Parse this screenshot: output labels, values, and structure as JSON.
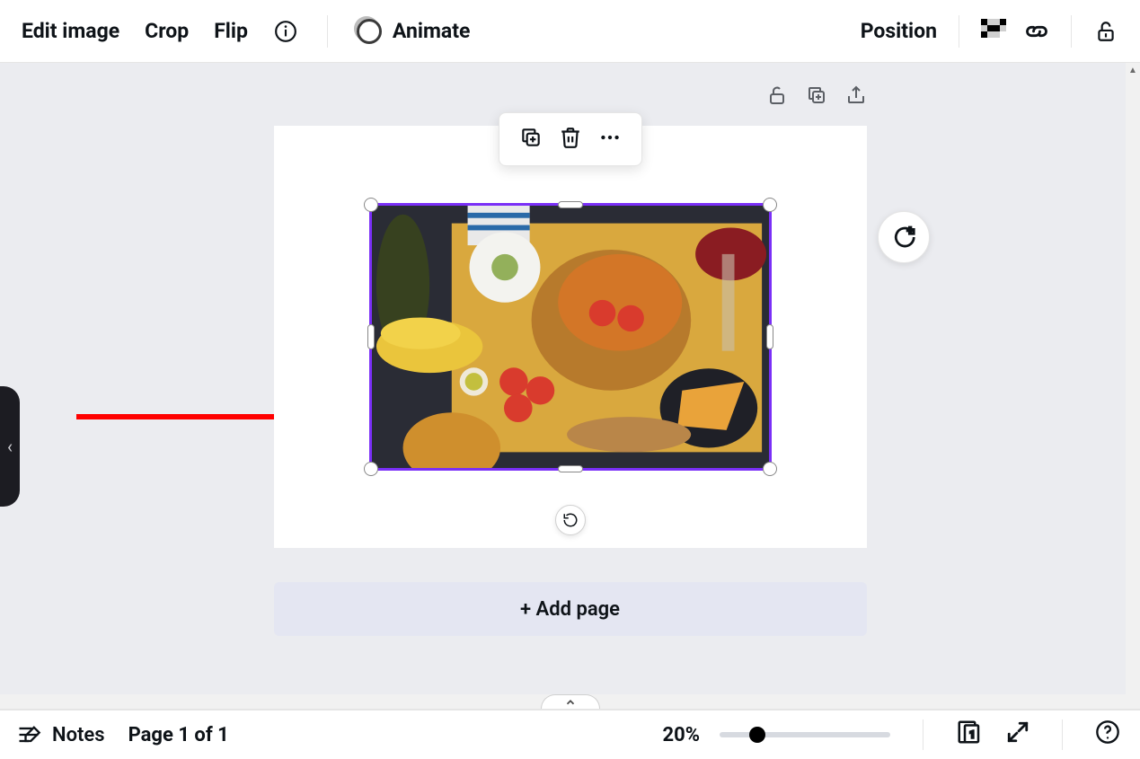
{
  "toolbar": {
    "edit_image": "Edit image",
    "crop": "Crop",
    "flip": "Flip",
    "animate": "Animate",
    "position": "Position"
  },
  "page_tools": {
    "lock": "unlock-page",
    "duplicate": "duplicate-page",
    "share": "share-page"
  },
  "float_toolbar": {
    "copy": "duplicate",
    "delete": "delete",
    "more": "more"
  },
  "selected_image": {
    "description": "food-flatlay-image"
  },
  "add_page": "+ Add page",
  "bottom": {
    "notes": "Notes",
    "page_indicator": "Page 1 of 1",
    "zoom": "20%"
  }
}
